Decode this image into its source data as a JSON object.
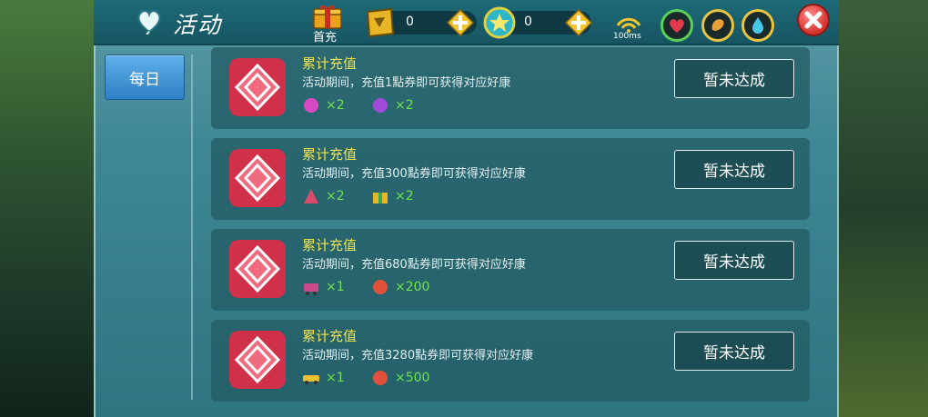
{
  "header": {
    "title": "活动",
    "first_recharge_label": "首充",
    "coupon_count": "0",
    "star_coin_count": "0",
    "ping": "100ms"
  },
  "sidebar": {
    "tabs": [
      {
        "label": "每日"
      }
    ]
  },
  "cards": [
    {
      "title": "累计充值",
      "desc": "活动期间，充值1點券即可获得对应好康",
      "rewards": [
        {
          "icon": "balloon-pink-icon",
          "qty": "×2"
        },
        {
          "icon": "candy-purple-icon",
          "qty": "×2"
        }
      ],
      "status": "暂未达成"
    },
    {
      "title": "累计充值",
      "desc": "活动期间，充值300點券即可获得对应好康",
      "rewards": [
        {
          "icon": "tent-icon",
          "qty": "×2"
        },
        {
          "icon": "gift-box-icon",
          "qty": "×2"
        }
      ],
      "status": "暂未达成"
    },
    {
      "title": "累计充值",
      "desc": "活动期间，充值680點券即可获得对应好康",
      "rewards": [
        {
          "icon": "cart-icon",
          "qty": "×1"
        },
        {
          "icon": "red-bean-icon",
          "qty": "×200"
        }
      ],
      "status": "暂未达成"
    },
    {
      "title": "累计充值",
      "desc": "活动期间，充值3280點券即可获得对应好康",
      "rewards": [
        {
          "icon": "gold-car-icon",
          "qty": "×1"
        },
        {
          "icon": "red-bean-icon",
          "qty": "×500"
        }
      ],
      "status": "暂未达成"
    }
  ],
  "colors": {
    "title_yellow": "#f2e24c",
    "reward_green": "#6ee34c",
    "tab_blue": "#3d8fd2"
  }
}
